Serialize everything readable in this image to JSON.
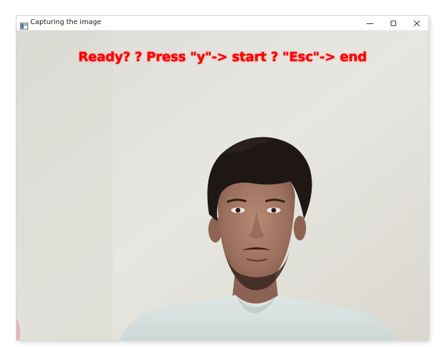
{
  "window": {
    "title": "Capturing the image",
    "controls": {
      "minimize_icon": "minimize-icon",
      "maximize_icon": "maximize-icon",
      "close_icon": "close-icon"
    }
  },
  "video": {
    "overlay_text": "Ready? ? Press \"y\"-> start ? \"Esc\"-> end",
    "overlay_color": "#ff0000",
    "content": "webcam-feed"
  }
}
